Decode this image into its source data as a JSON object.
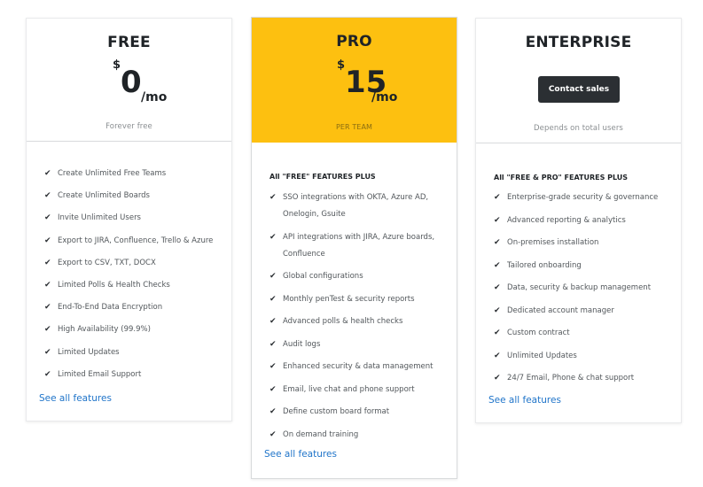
{
  "plans": {
    "free": {
      "name": "FREE",
      "currency": "$",
      "amount": "0",
      "per": "/mo",
      "sub": "Forever free",
      "features": [
        "Create Unlimited Free Teams",
        "Create Unlimited Boards",
        "Invite Unlimited Users",
        "Export to JIRA, Confluence, Trello & Azure",
        "Export to CSV, TXT, DOCX",
        "Limited Polls & Health Checks",
        "End-To-End Data Encryption",
        "High Availability (99.9%)",
        "Limited Updates",
        "Limited Email Support"
      ],
      "see_all": "See all features"
    },
    "pro": {
      "name": "PRO",
      "currency": "$",
      "amount": "15",
      "per": "/mo",
      "sub": "PER TEAM",
      "section_head": "All \"FREE\" FEATURES PLUS",
      "features": [
        "SSO integrations with OKTA, Azure AD, Onelogin, Gsuite",
        "API integrations with JIRA, Azure boards, Confluence",
        "Global configurations",
        "Monthly penTest & security reports",
        "Advanced polls & health checks",
        "Audit logs",
        "Enhanced security & data management",
        "Email, live chat and phone support",
        "Define custom board format",
        "On demand training"
      ],
      "see_all": "See all features",
      "accent": "#fdc010"
    },
    "enterprise": {
      "name": "ENTERPRISE",
      "cta": "Contact sales",
      "sub": "Depends on total users",
      "section_head": "All \"FREE & PRO\" FEATURES PLUS",
      "features": [
        "Enterprise-grade security & governance",
        "Advanced reporting & analytics",
        "On-premises installation",
        "Tailored onboarding",
        "Data, security & backup management",
        "Dedicated account manager",
        "Custom contract",
        "Unlimited Updates",
        "24/7 Email, Phone & chat support"
      ],
      "see_all": "See all features"
    }
  },
  "icons": {
    "feature_check": "check-icon"
  }
}
